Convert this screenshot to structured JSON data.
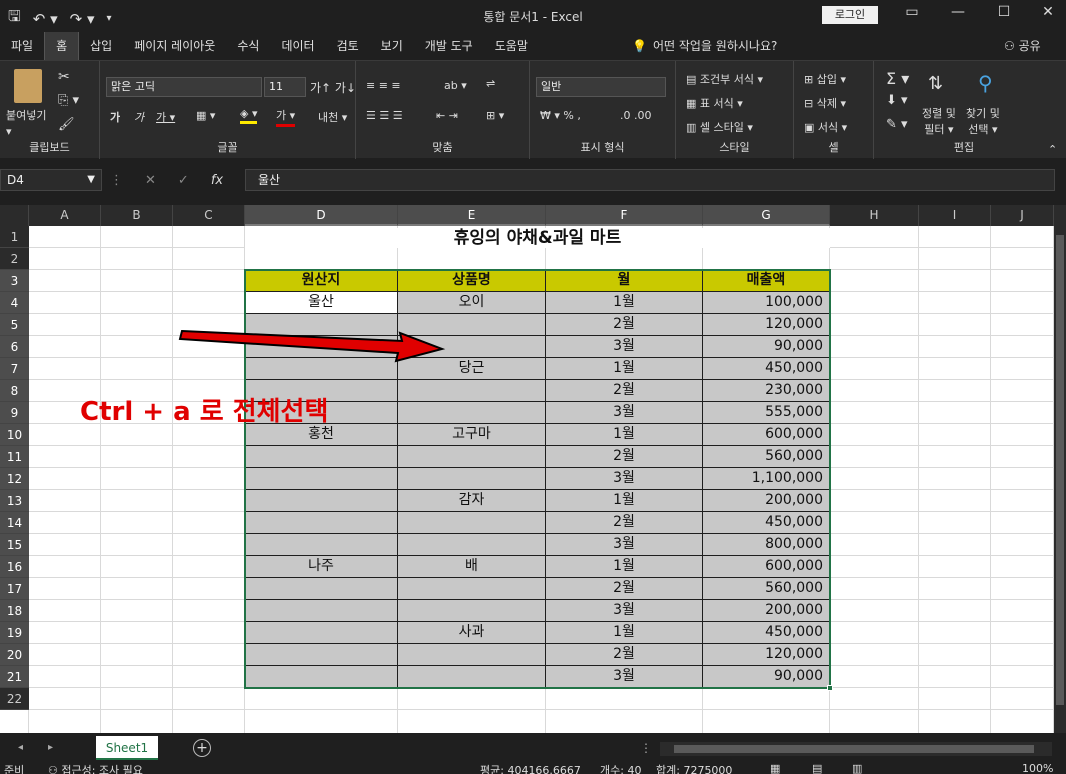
{
  "titlebar": {
    "title": "통합 문서1  -  Excel",
    "login": "로그인"
  },
  "menu": [
    "파일",
    "홈",
    "삽입",
    "페이지 레이아웃",
    "수식",
    "데이터",
    "검토",
    "보기",
    "개발 도구",
    "도움말"
  ],
  "tell_me": "어떤 작업을 원하시나요?",
  "share": "공유",
  "ribbon": {
    "paste": "붙여넣기",
    "font_name": "맑은 고딕",
    "font_size": "11",
    "number_format": "일반",
    "conditional": "조건부 서식",
    "table_format": "표 서식",
    "cell_style": "셀 스타일",
    "insert": "삽입",
    "delete": "삭제",
    "format": "서식",
    "sort_filter_1": "정렬 및",
    "sort_filter_2": "필터",
    "find_select_1": "찾기 및",
    "find_select_2": "선택",
    "groups": {
      "clipboard": "클립보드",
      "font": "글꼴",
      "align": "맞춤",
      "number": "표시 형식",
      "style": "스타일",
      "cells": "셀",
      "editing": "편집"
    }
  },
  "formula": {
    "name_box": "D4",
    "fx": "fx",
    "content": "울산"
  },
  "columns": [
    "A",
    "B",
    "C",
    "D",
    "E",
    "F",
    "G",
    "H",
    "I",
    "J"
  ],
  "rows": [
    "1",
    "2",
    "3",
    "4",
    "5",
    "6",
    "7",
    "8",
    "9",
    "10",
    "11",
    "12",
    "13",
    "14",
    "15",
    "16",
    "17",
    "18",
    "19",
    "20",
    "21",
    "22"
  ],
  "sheet": {
    "title": "휴잉의 야채&과일 마트",
    "headers": [
      "원산지",
      "상품명",
      "월",
      "매출액"
    ],
    "data": [
      [
        "울산",
        "오이",
        "1월",
        "100,000"
      ],
      [
        "",
        "",
        "2월",
        "120,000"
      ],
      [
        "",
        "",
        "3월",
        "90,000"
      ],
      [
        "",
        "당근",
        "1월",
        "450,000"
      ],
      [
        "",
        "",
        "2월",
        "230,000"
      ],
      [
        "",
        "",
        "3월",
        "555,000"
      ],
      [
        "홍천",
        "고구마",
        "1월",
        "600,000"
      ],
      [
        "",
        "",
        "2월",
        "560,000"
      ],
      [
        "",
        "",
        "3월",
        "1,100,000"
      ],
      [
        "",
        "감자",
        "1월",
        "200,000"
      ],
      [
        "",
        "",
        "2월",
        "450,000"
      ],
      [
        "",
        "",
        "3월",
        "800,000"
      ],
      [
        "나주",
        "배",
        "1월",
        "600,000"
      ],
      [
        "",
        "",
        "2월",
        "560,000"
      ],
      [
        "",
        "",
        "3월",
        "200,000"
      ],
      [
        "",
        "사과",
        "1월",
        "450,000"
      ],
      [
        "",
        "",
        "2월",
        "120,000"
      ],
      [
        "",
        "",
        "3월",
        "90,000"
      ]
    ],
    "annotation": "Ctrl + a 로 전체선택"
  },
  "tabs": {
    "sheet1": "Sheet1",
    "add": "+"
  },
  "status": {
    "ready": "준비",
    "access": "접근성: 조사 필요",
    "average": "평균: 404166.6667",
    "count": "개수: 40",
    "sum": "합계: 7275000",
    "zoom": "100%"
  },
  "colors": {
    "header_fill": "#c9c900",
    "selected_fill": "#c8c8c8",
    "annotation": "#e00000",
    "selection_border": "#217346"
  }
}
